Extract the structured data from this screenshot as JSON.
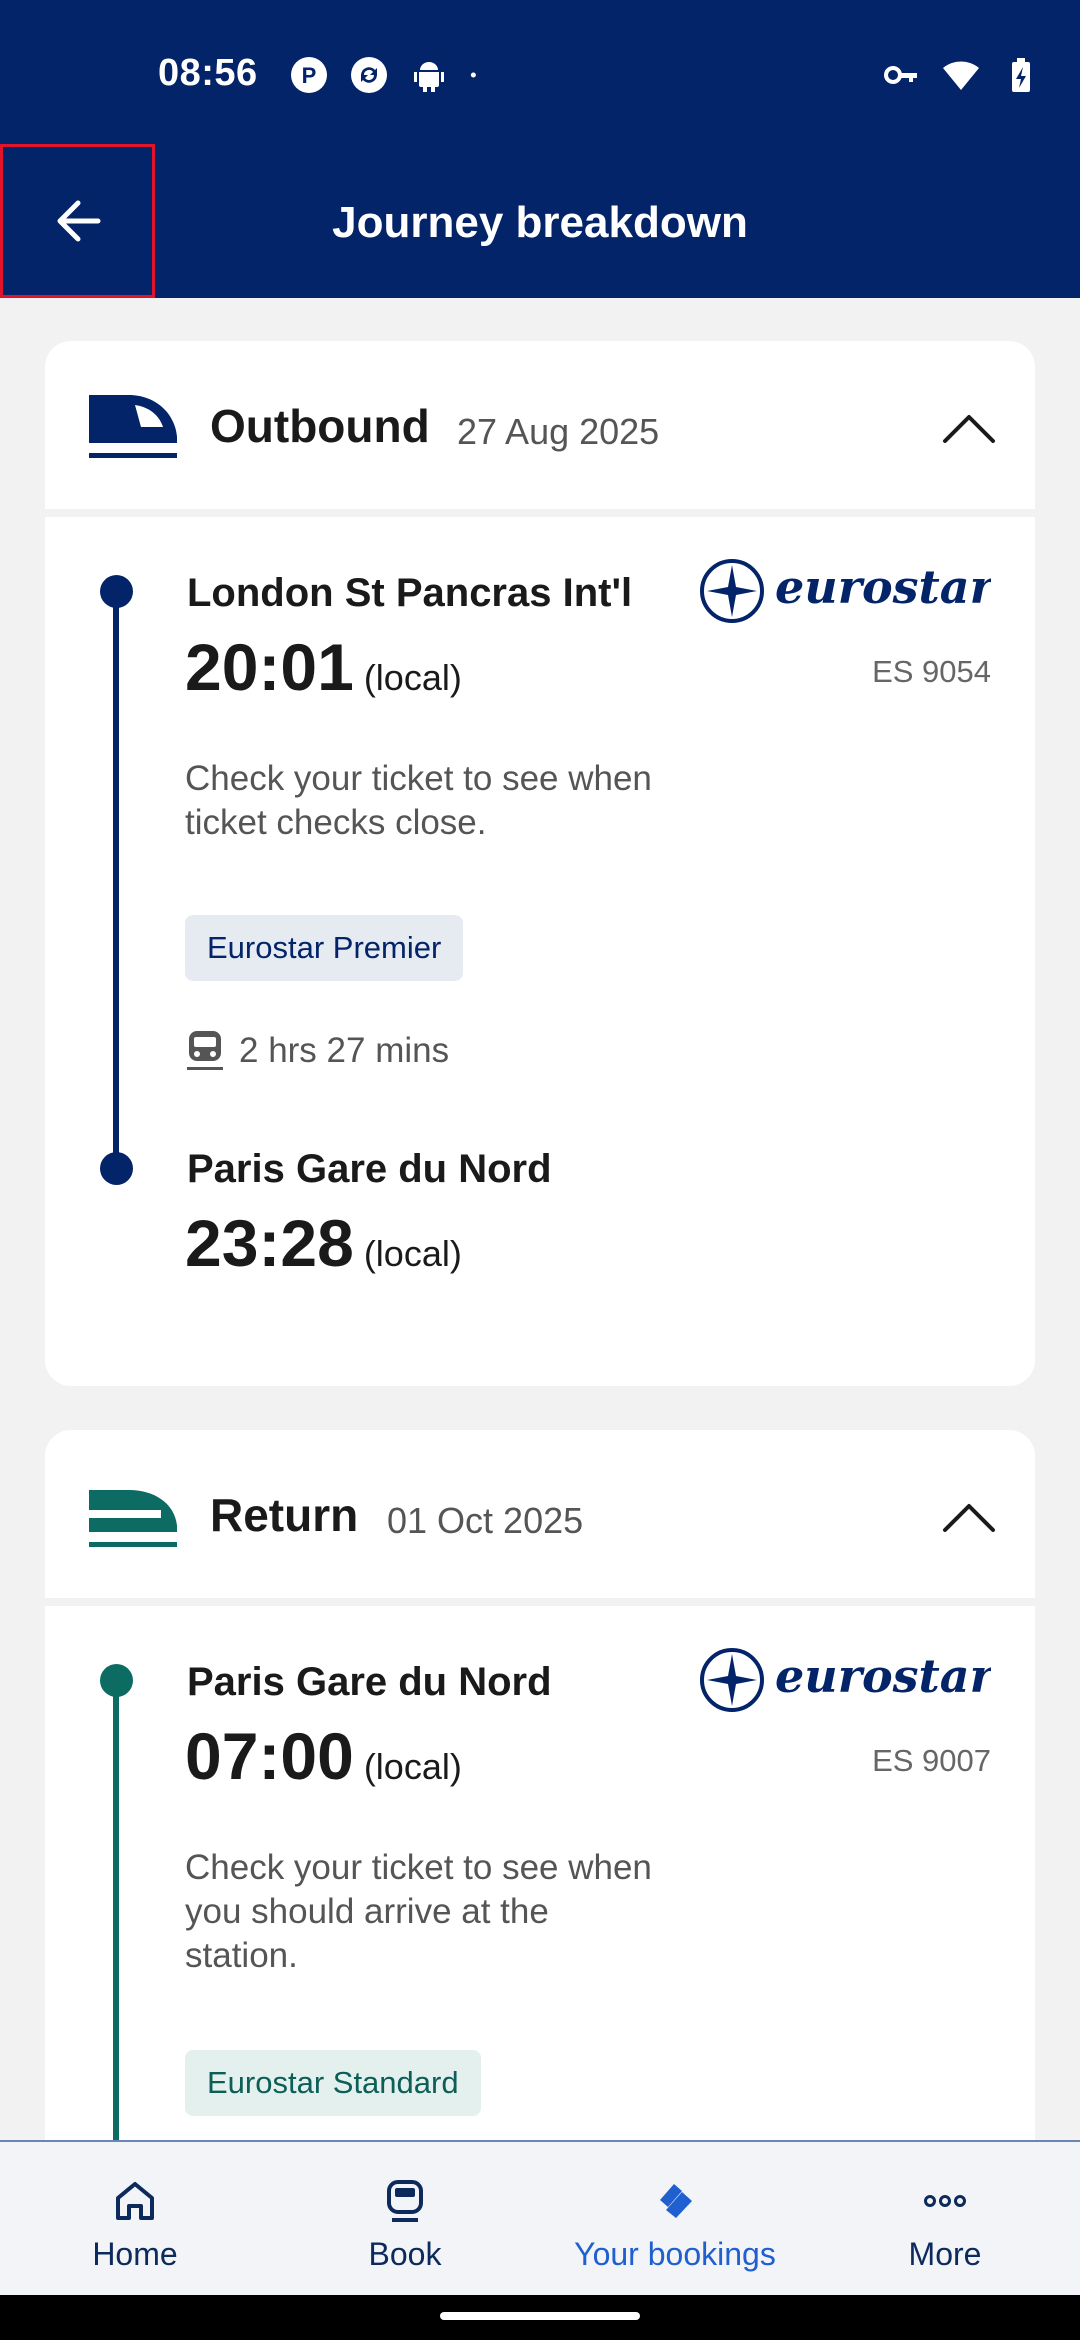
{
  "status_bar": {
    "time": "08:56",
    "icons_left": [
      "p-badge-icon",
      "sync-icon",
      "android-icon",
      "dot-icon"
    ],
    "icons_right": [
      "vpn-key-icon",
      "wifi-icon",
      "battery-charging-icon"
    ]
  },
  "header": {
    "title": "Journey breakdown",
    "back_icon": "arrow-back-icon",
    "background": "#032468"
  },
  "outbound": {
    "title": "Outbound",
    "date": "27 Aug 2025",
    "accent": "#032468",
    "brand": "eurostar",
    "train_code": "ES 9054",
    "departure": {
      "station": "London St Pancras Int'l",
      "time": "20:01",
      "time_suffix": "(local)"
    },
    "note": "Check your ticket to see when ticket checks close.",
    "class": "Eurostar Premier",
    "duration": "2 hrs 27 mins",
    "arrival": {
      "station": "Paris Gare du Nord",
      "time": "23:28",
      "time_suffix": "(local)"
    }
  },
  "return": {
    "title": "Return",
    "date": "01 Oct 2025",
    "accent": "#0c6b63",
    "brand": "eurostar",
    "train_code": "ES 9007",
    "departure": {
      "station": "Paris Gare du Nord",
      "time": "07:00",
      "time_suffix": "(local)"
    },
    "note": "Check your ticket to see when you should arrive at the station.",
    "class": "Eurostar Standard"
  },
  "bottom_nav": {
    "items": [
      {
        "label": "Home",
        "icon": "home-icon"
      },
      {
        "label": "Book",
        "icon": "train-icon"
      },
      {
        "label": "Your bookings",
        "icon": "tickets-icon",
        "active": true
      },
      {
        "label": "More",
        "icon": "more-dots-icon"
      }
    ]
  }
}
